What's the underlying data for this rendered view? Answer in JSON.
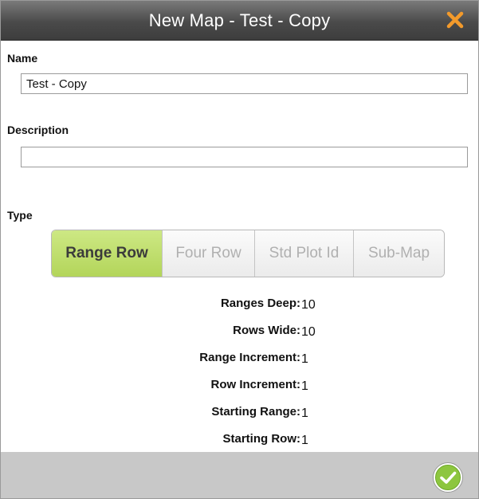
{
  "window": {
    "title": "New Map - Test - Copy"
  },
  "icons": {
    "close": "close-x-icon",
    "confirm": "green-check-circle-icon"
  },
  "colors": {
    "close_icon": "#f39a2b",
    "active_type": "#c2df6c",
    "confirm": "#8dc63f",
    "footer": "#c8c8c8"
  },
  "form": {
    "name_label": "Name",
    "name_value": "Test - Copy",
    "description_label": "Description",
    "description_value": "",
    "type_label": "Type"
  },
  "type_options": [
    {
      "label": "Range Row",
      "selected": true
    },
    {
      "label": "Four Row",
      "selected": false
    },
    {
      "label": "Std Plot Id",
      "selected": false
    },
    {
      "label": "Sub-Map",
      "selected": false
    }
  ],
  "params": [
    {
      "label": "Ranges Deep:",
      "value": "10"
    },
    {
      "label": "Rows Wide:",
      "value": "10"
    },
    {
      "label": "Range Increment:",
      "value": "1"
    },
    {
      "label": "Row Increment:",
      "value": "1"
    },
    {
      "label": "Starting Range:",
      "value": "1"
    },
    {
      "label": "Starting Row:",
      "value": "1"
    }
  ]
}
